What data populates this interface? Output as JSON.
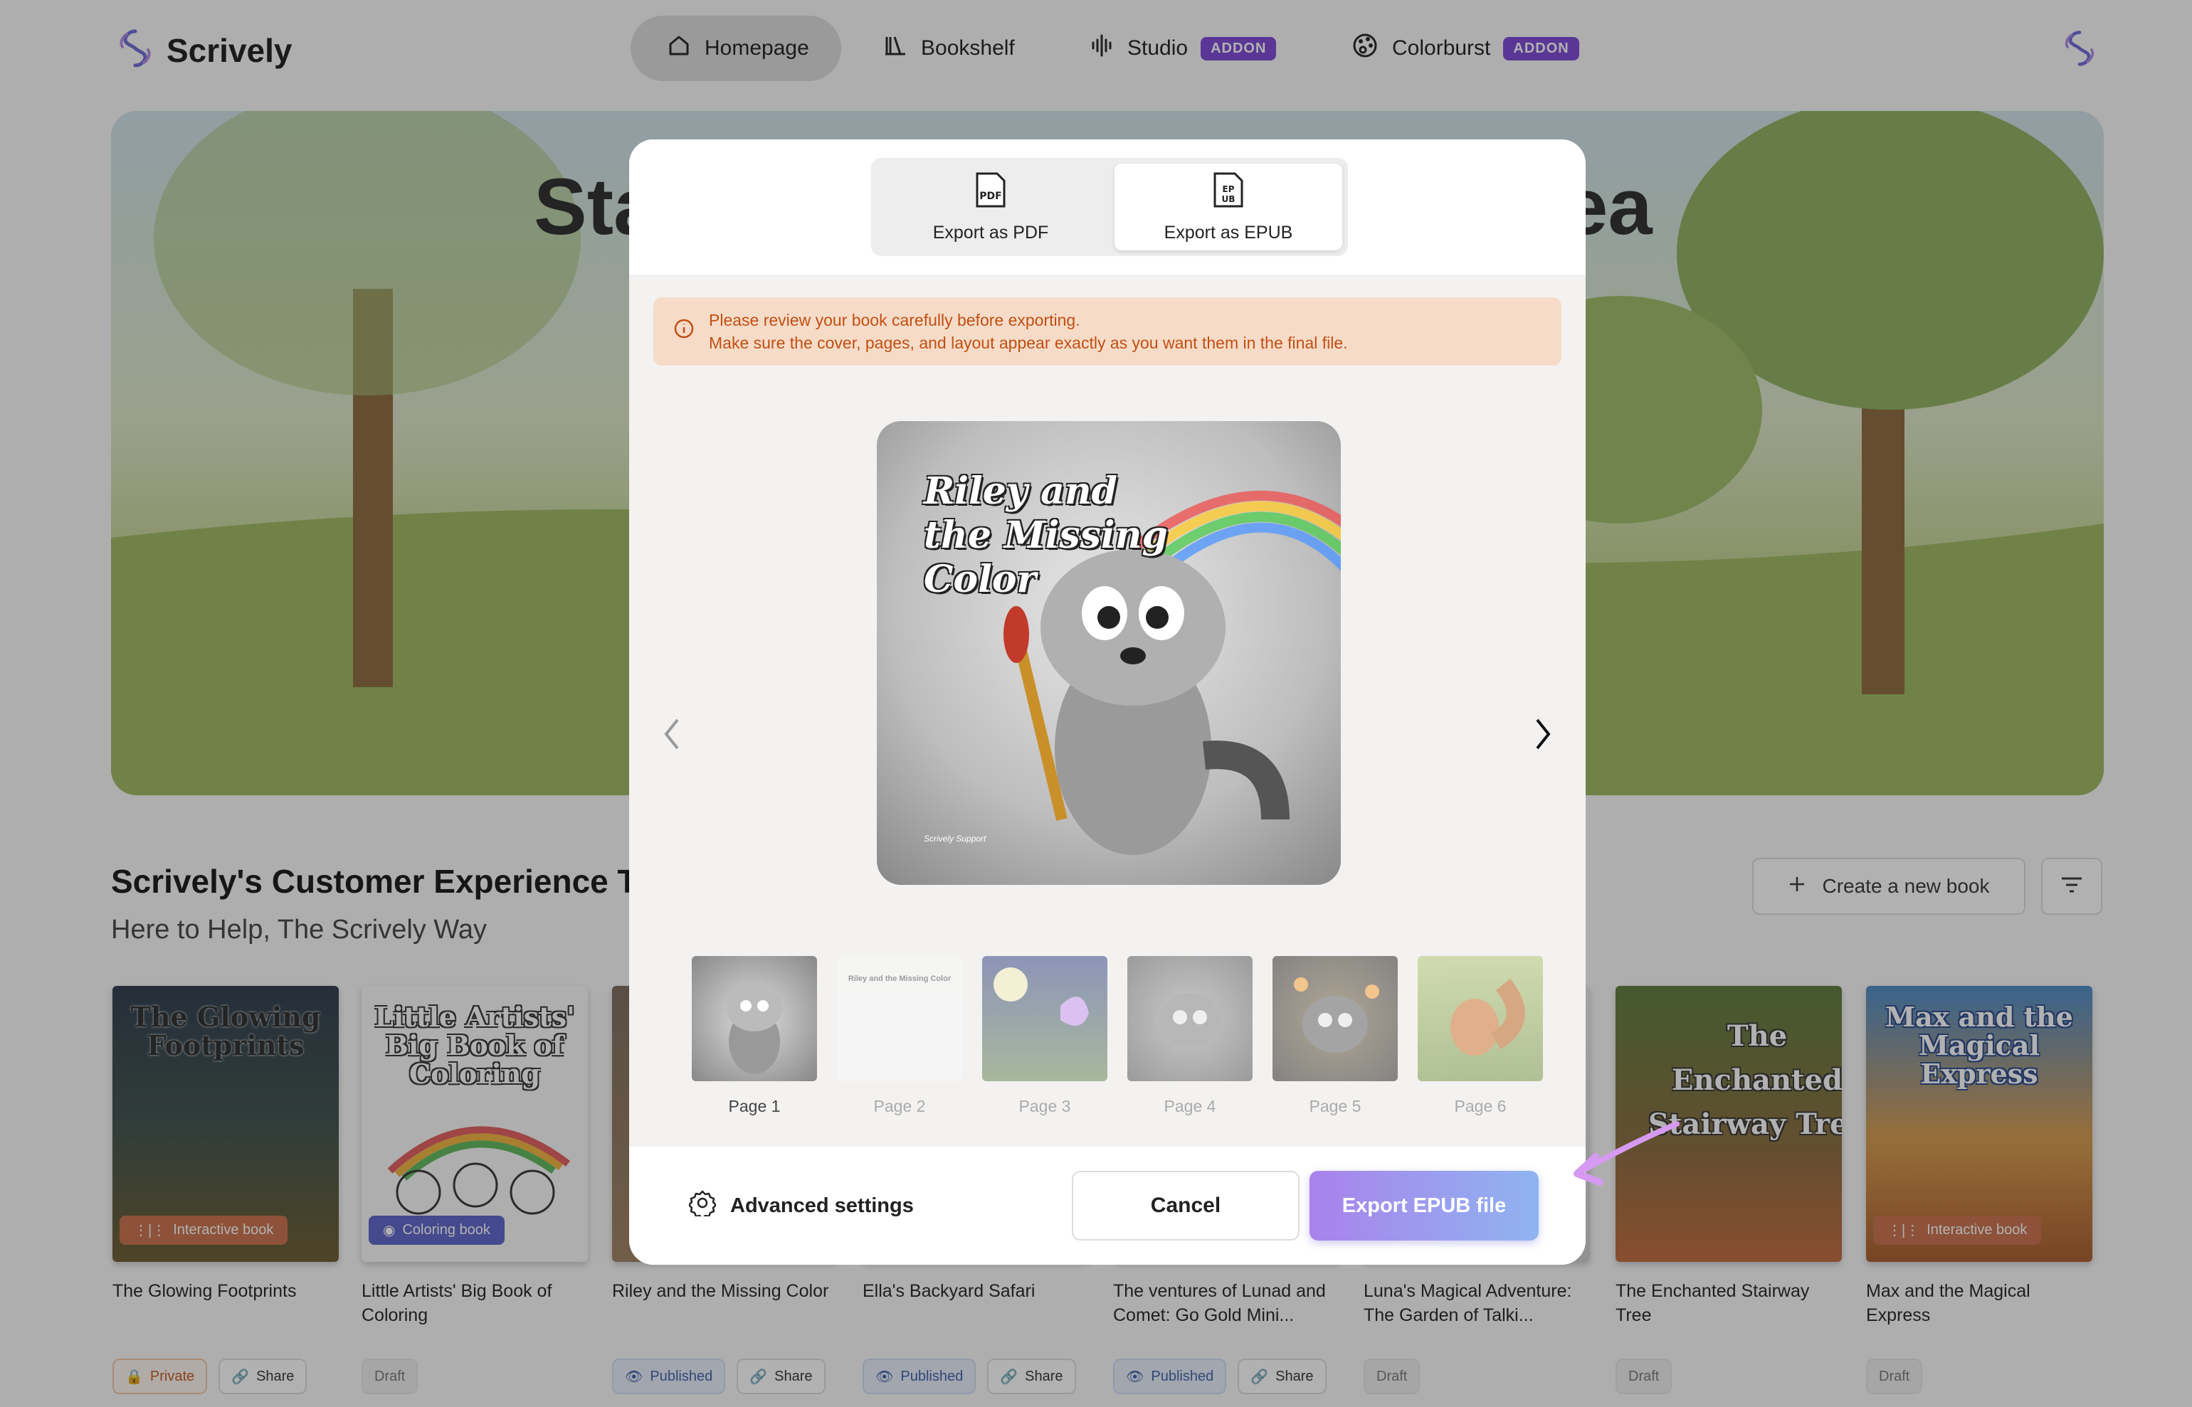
{
  "app": {
    "name": "Scrively"
  },
  "nav": {
    "items": [
      {
        "label": "Homepage"
      },
      {
        "label": "Bookshelf"
      },
      {
        "label": "Studio",
        "badge": "ADDON"
      },
      {
        "label": "Colorburst",
        "badge": "ADDON"
      }
    ]
  },
  "hero": {
    "title_left": "Sta",
    "title_right": "lea"
  },
  "section": {
    "title": "Scrively's Customer Experience T",
    "subtitle": "Here to Help, The Scrively Way"
  },
  "create_button": {
    "label": "Create a new book"
  },
  "books": [
    {
      "cover_title": "The Glowing Footprints",
      "type": "Interactive book",
      "title": "The Glowing Footprints",
      "status": "Private",
      "share": "Share"
    },
    {
      "cover_title": "Little Artists' Big Book of Coloring",
      "type": "Coloring book",
      "title": "Little Artists' Big Book of Coloring",
      "status": "Draft"
    },
    {
      "title": "Riley and the Missing Color",
      "status": "Published",
      "share": "Share"
    },
    {
      "title": "Ella's Backyard Safari",
      "status": "Published",
      "share": "Share"
    },
    {
      "title": "The ventures of Lunad and Comet: Go Gold Mini...",
      "status": "Published",
      "share": "Share"
    },
    {
      "title": "Luna's Magical Adventure: The Garden of Talki...",
      "status": "Draft"
    },
    {
      "cover_title": "The Enchanted Stairway Tree",
      "title": "The Enchanted Stairway Tree",
      "status": "Draft"
    },
    {
      "cover_title": "Max and the Magical Express",
      "type": "Interactive book",
      "title": "Max and the Magical Express",
      "status": "Draft"
    }
  ],
  "modal": {
    "tabs": [
      {
        "icon_text": "PDF",
        "label": "Export as PDF"
      },
      {
        "icon_text": "EP UB",
        "label": "Export as EPUB"
      }
    ],
    "warning": {
      "line1": "Please review your book carefully before exporting.",
      "line2": "Make sure the cover, pages, and layout appear exactly as you want them in the final file."
    },
    "preview": {
      "title_line1": "Riley and",
      "title_line2": "the Missing",
      "title_line3": "Color",
      "signature": "Scrively Support"
    },
    "pages": [
      {
        "label": "Page 1"
      },
      {
        "label": "Page 2",
        "mini_title": "Riley and the Missing Color"
      },
      {
        "label": "Page 3"
      },
      {
        "label": "Page 4"
      },
      {
        "label": "Page 5"
      },
      {
        "label": "Page 6"
      }
    ],
    "footer": {
      "advanced": "Advanced settings",
      "cancel": "Cancel",
      "export": "Export EPUB file"
    }
  }
}
